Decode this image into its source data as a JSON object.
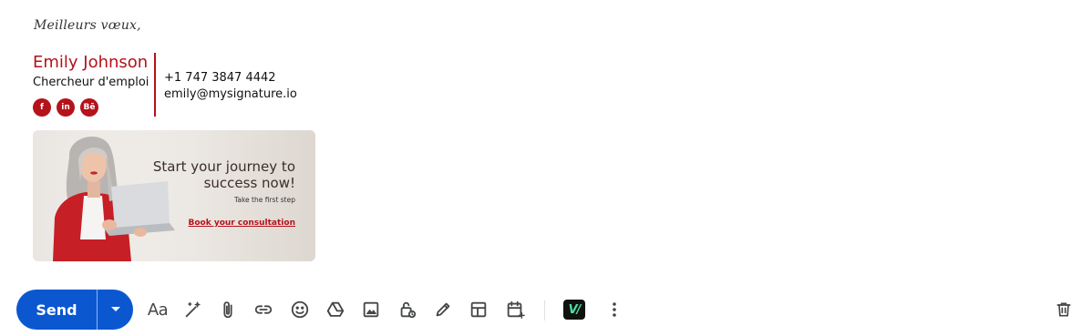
{
  "signature": {
    "greeting": "Meilleurs vœux,",
    "name": "Emily Johnson",
    "role": "Chercheur d'emploi",
    "phone": "+1 747 3847 4442",
    "email": "emily@mysignature.io",
    "social": [
      {
        "icon": "facebook-icon",
        "glyph": "f"
      },
      {
        "icon": "linkedin-icon",
        "glyph": "in"
      },
      {
        "icon": "behance-icon",
        "glyph": "Bē"
      }
    ],
    "accent_color": "#b5121b"
  },
  "banner": {
    "title": "Start your journey to success now!",
    "subtitle": "Take the first step",
    "cta": "Book your consultation"
  },
  "toolbar": {
    "send_label": "Send",
    "format_label": "Aa",
    "extension_label": "V/",
    "send_color": "#0b57d0",
    "icons": [
      "more-send-options-icon",
      "formatting-options-icon",
      "help-me-write-icon",
      "attach-file-icon",
      "insert-link-icon",
      "insert-emoji-icon",
      "insert-drive-file-icon",
      "insert-photo-icon",
      "confidential-mode-icon",
      "insert-signature-icon",
      "layouts-icon",
      "set-up-time-icon",
      "signature-extension-icon",
      "more-options-icon",
      "discard-draft-icon"
    ]
  }
}
